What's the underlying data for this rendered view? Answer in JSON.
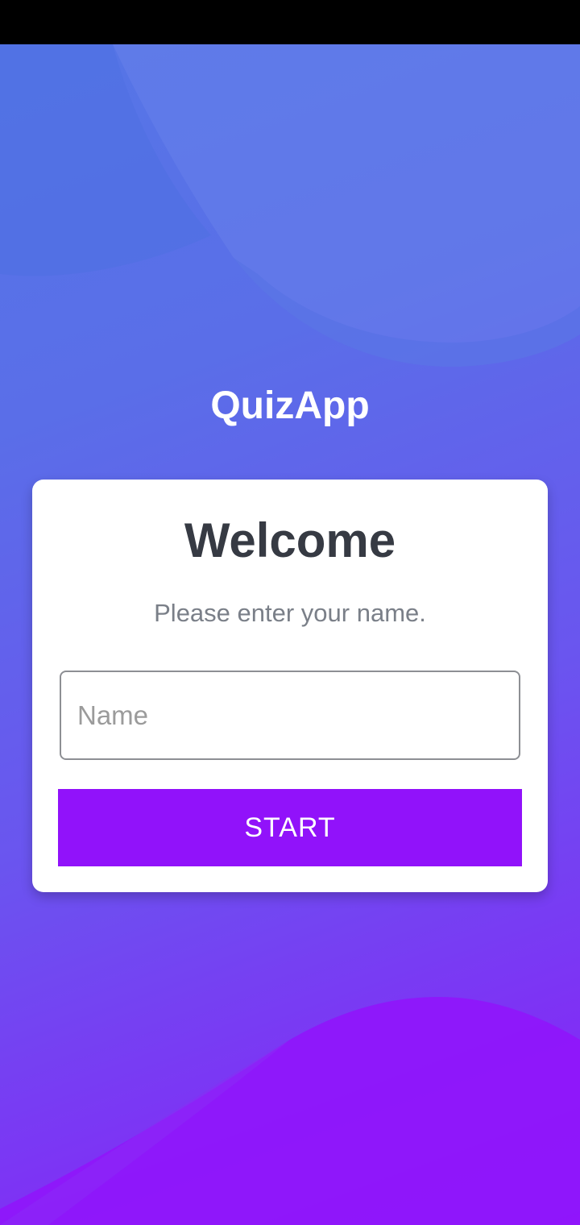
{
  "app": {
    "title": "QuizApp"
  },
  "card": {
    "heading": "Welcome",
    "subtitle": "Please enter your name.",
    "name_input": {
      "placeholder": "Name",
      "value": ""
    },
    "start_button_label": "START"
  },
  "colors": {
    "status_bar": "#000000",
    "gradient_top": "#5577e6",
    "gradient_bottom": "#8a1cf8",
    "button": "#9112fa",
    "heading_text": "#363a43",
    "subtitle_text": "#7a7f88"
  }
}
